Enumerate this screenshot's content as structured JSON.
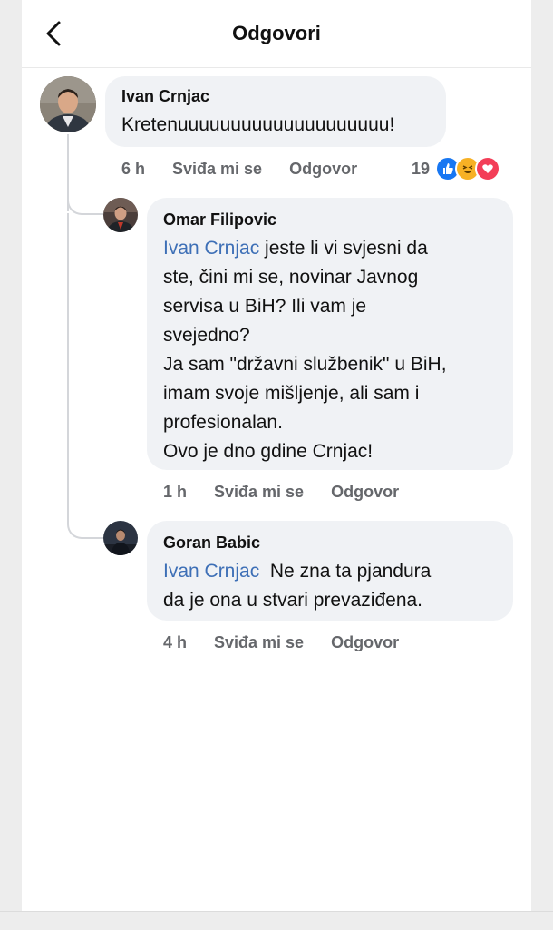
{
  "header": {
    "title": "Odgovori"
  },
  "comments": [
    {
      "author": "Ivan Crnjac",
      "text": "Kretenuuuuuuuuuuuuuuuuuuuu!",
      "time": "6 h",
      "like_label": "Sviđa mi se",
      "reply_label": "Odgovor",
      "reaction_count": "19",
      "reactions": [
        "like-icon",
        "haha-icon",
        "love-icon"
      ]
    },
    {
      "author": "Omar Filipovic",
      "mention": "Ivan Crnjac",
      "lines": [
        " jeste li vi svjesni da",
        "ste, čini mi se, novinar Javnog",
        "servisa u BiH? Ili vam je",
        "svejedno?",
        "Ja sam \"državni službenik\" u BiH,",
        "imam svoje mišljenje, ali sam i",
        "profesionalan.",
        "Ovo je dno gdine Crnjac!"
      ],
      "time": "1 h",
      "like_label": "Sviđa mi se",
      "reply_label": "Odgovor"
    },
    {
      "author": "Goran Babic",
      "mention": "Ivan Crnjac",
      "lines": [
        "  Ne zna ta pjandura",
        "da je ona u stvari prevaziđena."
      ],
      "time": "4 h",
      "like_label": "Sviđa mi se",
      "reply_label": "Odgovor"
    }
  ],
  "colors": {
    "mention": "#3d6fb6",
    "bubble": "#f0f2f5",
    "meta": "#65676b",
    "like": "#1877f2",
    "love": "#f33e58",
    "haha": "#f7b125"
  }
}
